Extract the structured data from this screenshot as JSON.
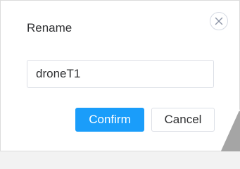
{
  "dialog": {
    "title": "Rename",
    "input": {
      "value": "droneT1"
    },
    "buttons": {
      "confirm_label": "Confirm",
      "cancel_label": "Cancel"
    },
    "close_icon": "close-icon"
  },
  "colors": {
    "primary": "#1a9dfa",
    "text": "#303133",
    "border": "#dcdfe6"
  }
}
